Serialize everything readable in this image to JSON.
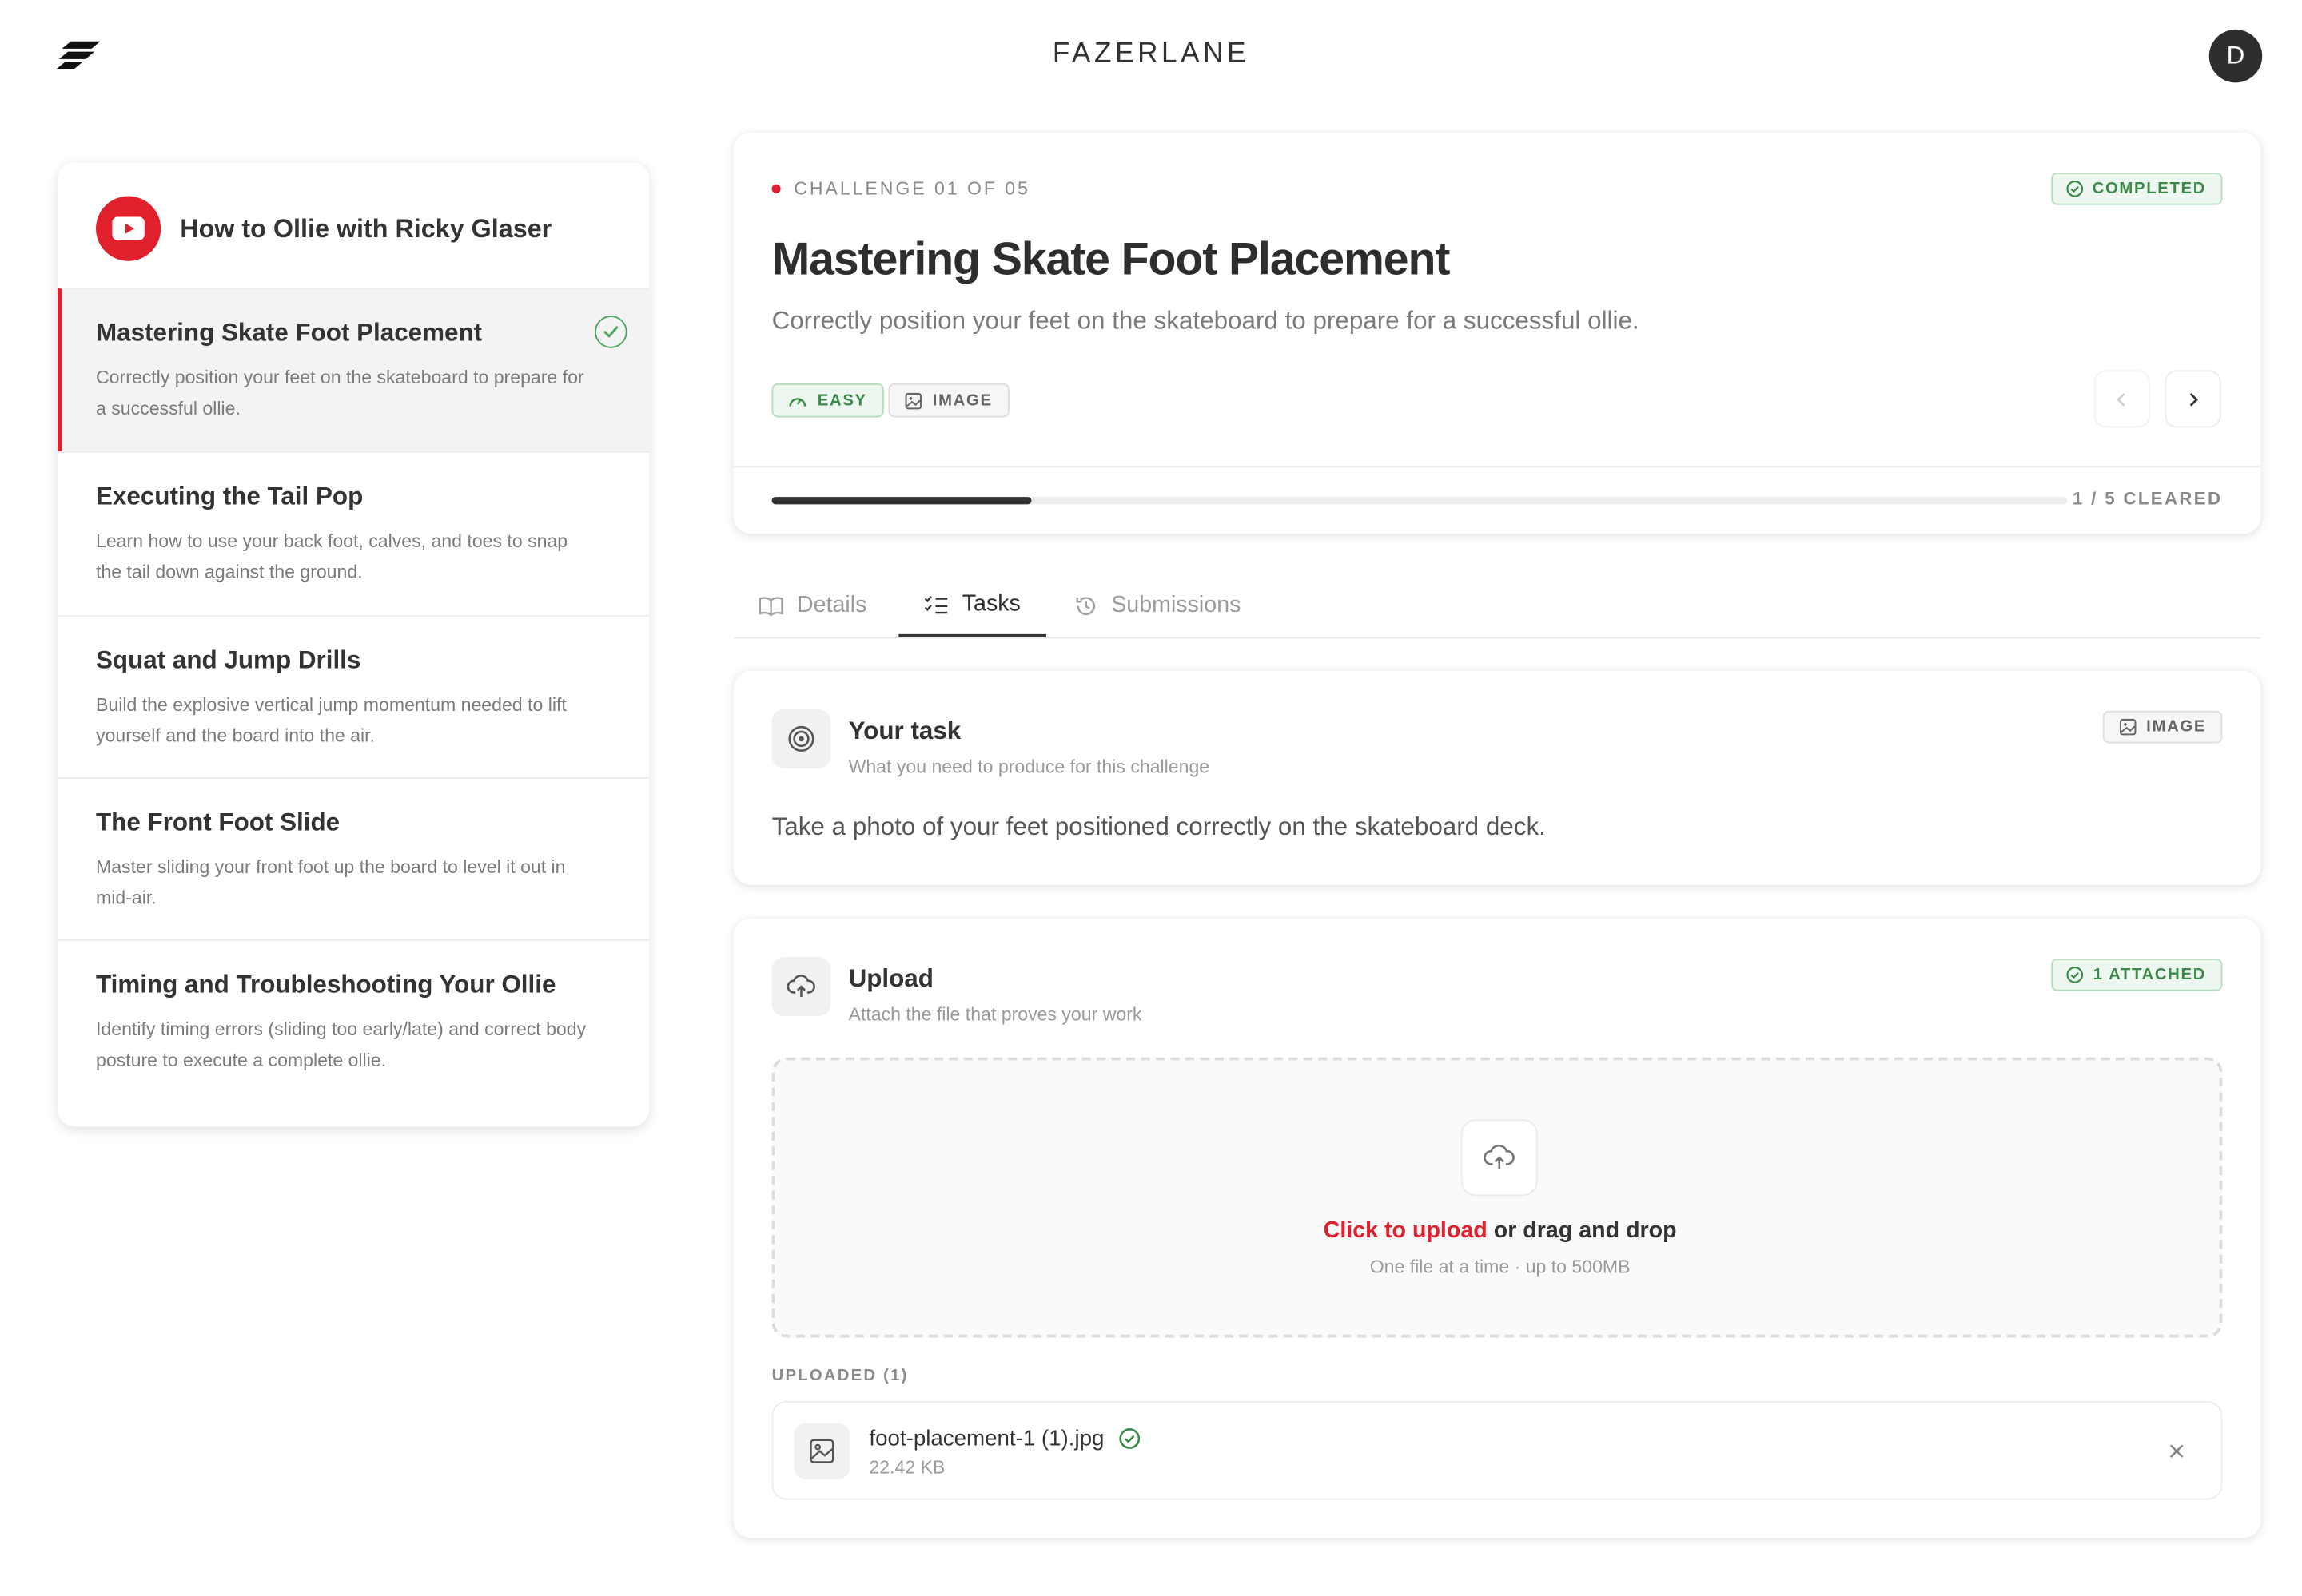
{
  "header": {
    "brand": "FAZERLANE",
    "avatar_initial": "D"
  },
  "sidebar": {
    "course_title": "How to Ollie with Ricky Glaser",
    "items": [
      {
        "title": "Mastering Skate Foot Placement",
        "desc": "Correctly position your feet on the skateboard to prepare for a successful ollie.",
        "active": true,
        "completed": true
      },
      {
        "title": "Executing the Tail Pop",
        "desc": "Learn how to use your back foot, calves, and toes to snap the tail down against the ground."
      },
      {
        "title": "Squat and Jump Drills",
        "desc": "Build the explosive vertical jump momentum needed to lift yourself and the board into the air."
      },
      {
        "title": "The Front Foot Slide",
        "desc": "Master sliding your front foot up the board to level it out in mid-air."
      },
      {
        "title": "Timing and Troubleshooting Your Ollie",
        "desc": "Identify timing errors (sliding too early/late) and correct body posture to execute a complete ollie."
      }
    ]
  },
  "challenge": {
    "eyebrow": "CHALLENGE 01 OF 05",
    "status": "COMPLETED",
    "title": "Mastering Skate Foot Placement",
    "subtitle": "Correctly position your feet on the skateboard to prepare for a successful ollie.",
    "difficulty": "EASY",
    "type": "IMAGE",
    "progress_fraction": 0.2,
    "progress_label": "1 / 5 CLEARED"
  },
  "tabs": [
    {
      "label": "Details",
      "icon": "book-open-icon"
    },
    {
      "label": "Tasks",
      "icon": "list-checks-icon",
      "active": true
    },
    {
      "label": "Submissions",
      "icon": "history-icon"
    }
  ],
  "task": {
    "title": "Your task",
    "subtitle": "What you need to produce for this challenge",
    "badge": "IMAGE",
    "text": "Take a photo of your feet positioned correctly on the skateboard deck."
  },
  "upload": {
    "title": "Upload",
    "subtitle": "Attach the file that proves your work",
    "badge": "1 ATTACHED",
    "click_text": "Click to upload",
    "drag_text": " or drag and drop",
    "hint": "One file at a time · up to 500MB",
    "uploaded_label": "UPLOADED (1)",
    "file": {
      "name": "foot-placement-1 (1).jpg",
      "size": "22.42 KB"
    }
  },
  "colors": {
    "accent": "#e0202c",
    "success": "#3b8a4a",
    "ink": "#333333"
  }
}
